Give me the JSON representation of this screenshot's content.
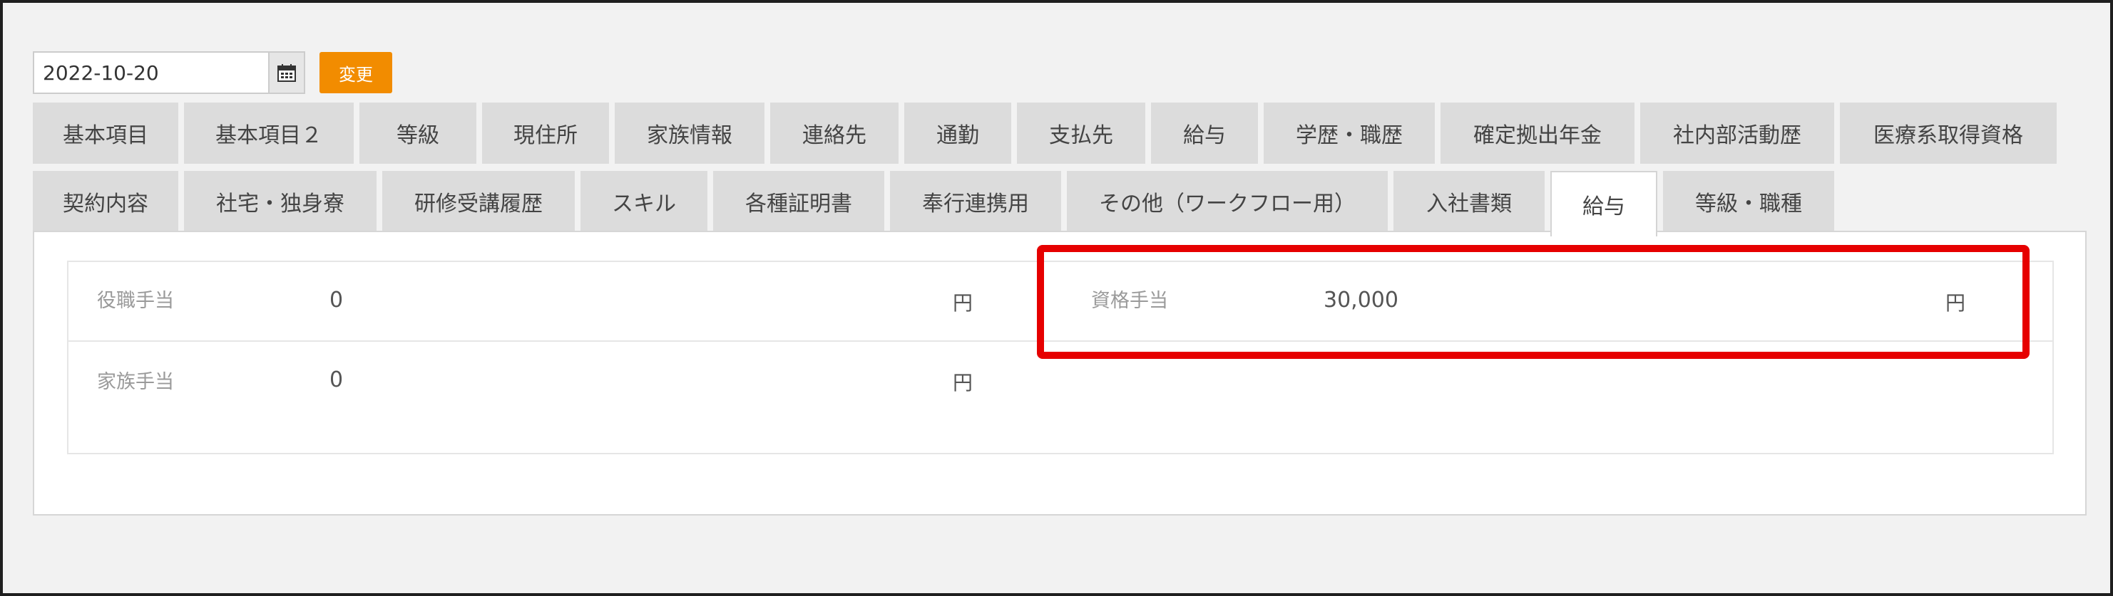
{
  "toolbar": {
    "date_value": "2022-10-20",
    "calendar_icon": "calendar-icon",
    "change_label": "変更",
    "accent_color": "#f28c00"
  },
  "tabs_row1": [
    {
      "label": "基本項目"
    },
    {
      "label": "基本項目２"
    },
    {
      "label": "等級"
    },
    {
      "label": "現住所"
    },
    {
      "label": "家族情報"
    },
    {
      "label": "連絡先"
    },
    {
      "label": "通勤"
    },
    {
      "label": "支払先"
    },
    {
      "label": "給与"
    },
    {
      "label": "学歴・職歴"
    },
    {
      "label": "確定拠出年金"
    },
    {
      "label": "社内部活動歴"
    },
    {
      "label": "医療系取得資格"
    }
  ],
  "tabs_row2": [
    {
      "label": "契約内容"
    },
    {
      "label": "社宅・独身寮"
    },
    {
      "label": "研修受講履歴"
    },
    {
      "label": "スキル"
    },
    {
      "label": "各種証明書"
    },
    {
      "label": "奉行連携用"
    },
    {
      "label": "その他（ワークフロー用）"
    },
    {
      "label": "入社書類"
    },
    {
      "label": "給与",
      "active": true
    },
    {
      "label": "等級・職種"
    }
  ],
  "fields": {
    "position_allowance": {
      "label": "役職手当",
      "value": "0",
      "unit": "円"
    },
    "qualification_allowance": {
      "label": "資格手当",
      "value": "30,000",
      "unit": "円"
    },
    "family_allowance": {
      "label": "家族手当",
      "value": "0",
      "unit": "円"
    }
  },
  "highlight_color": "#e60000"
}
